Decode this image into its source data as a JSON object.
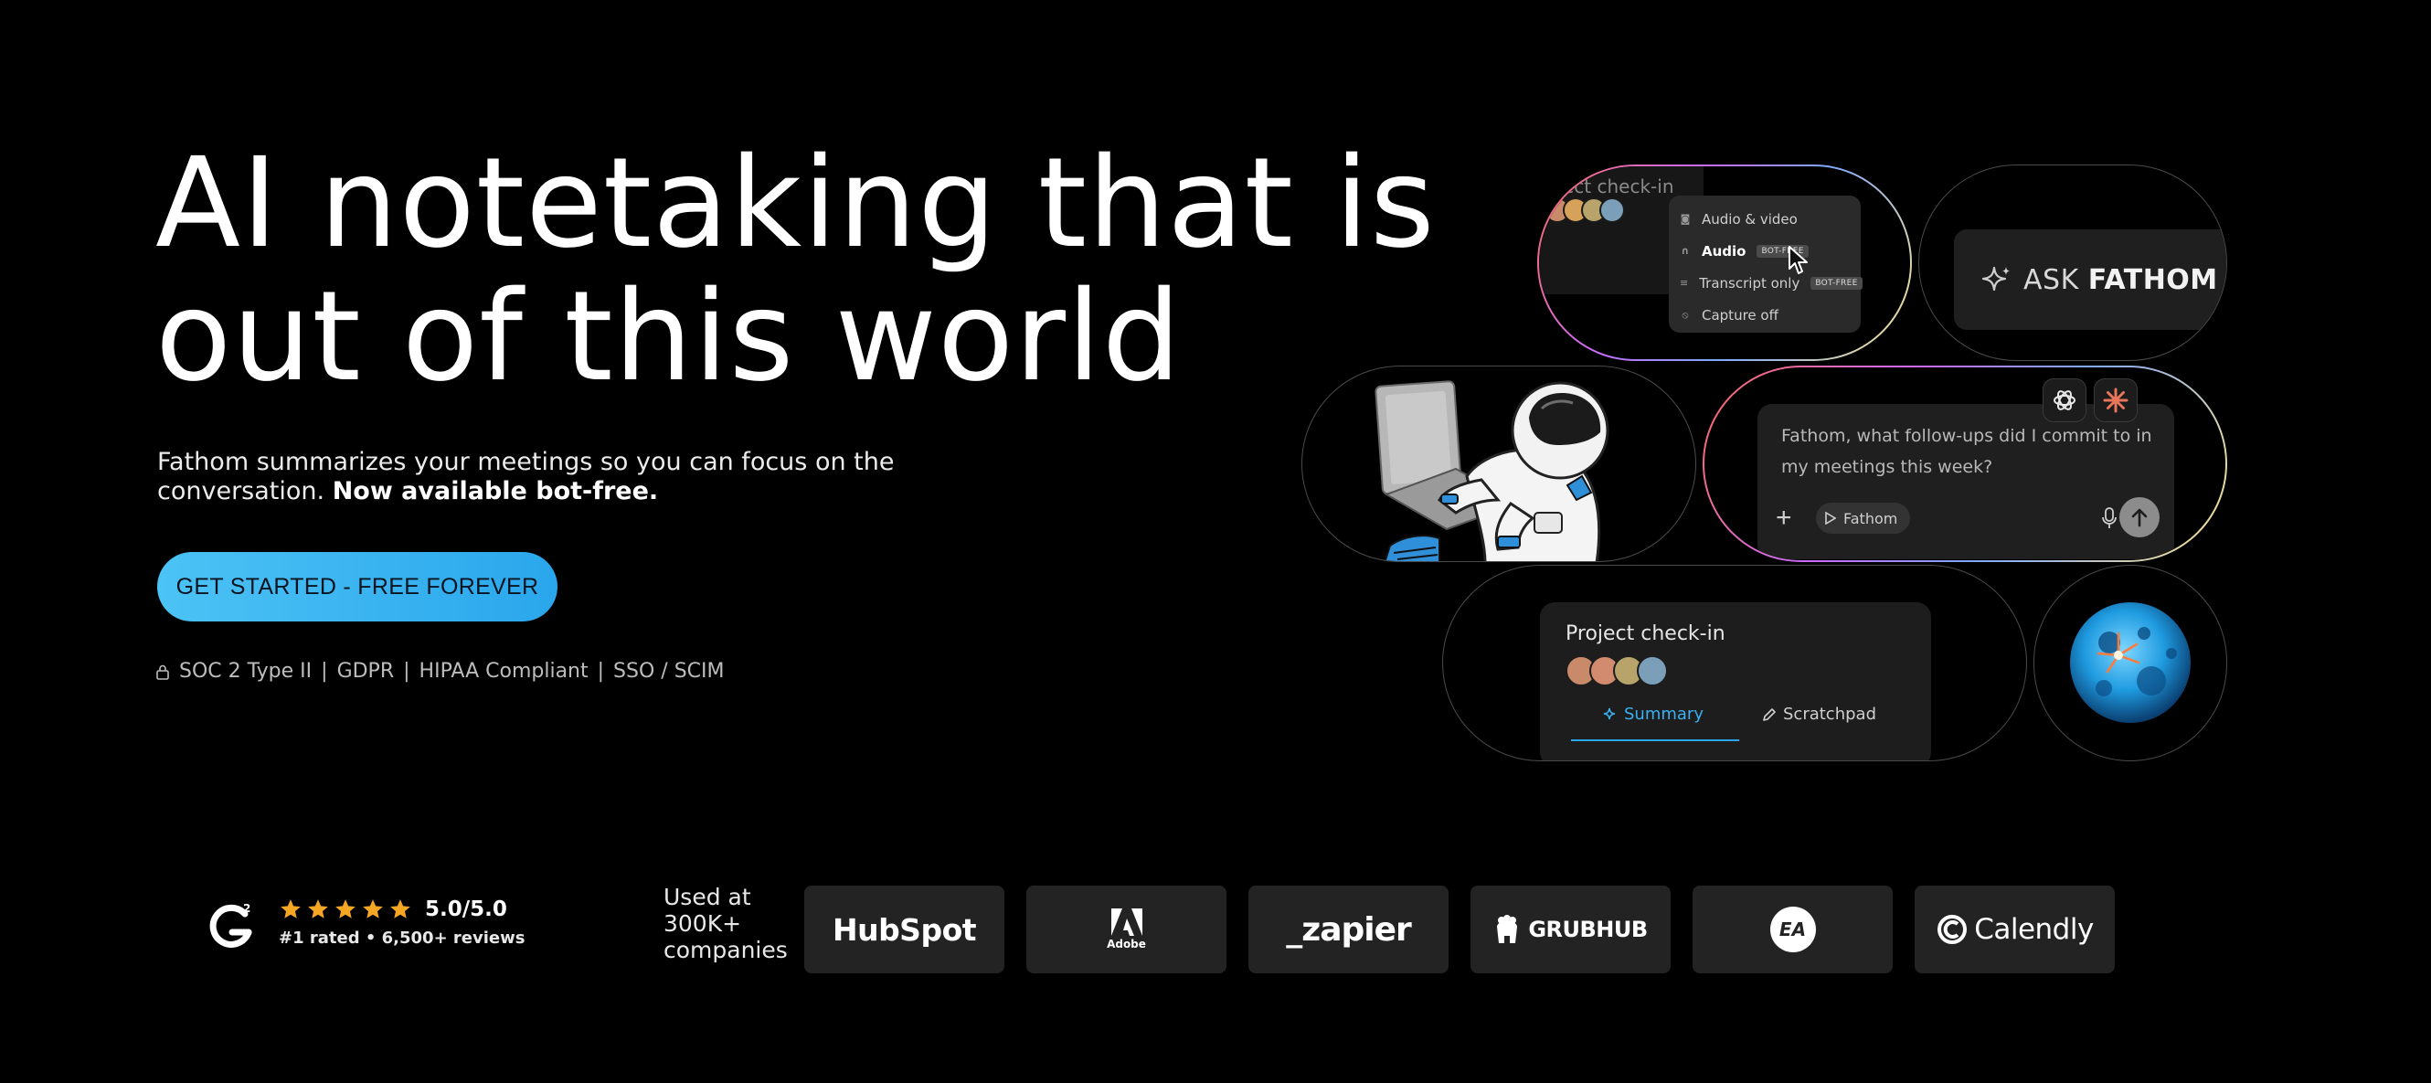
{
  "hero": {
    "headline_line1": "AI notetaking that is",
    "headline_line2": "out of this world",
    "subtitle_regular": "Fathom summarizes your meetings so you can focus on the conversation.",
    "subtitle_bold": "Now available bot-free.",
    "cta_label": "GET STARTED - FREE FOREVER",
    "compliance": [
      "SOC 2 Type II",
      "GDPR",
      "HIPAA Compliant",
      "SSO / SCIM"
    ],
    "separator": "|"
  },
  "recording_menu": {
    "card_title_partial": "ect check-in",
    "items": [
      {
        "label": "Audio & video",
        "tag": ""
      },
      {
        "label": "Audio",
        "tag": "BOT-FREE"
      },
      {
        "label": "Transcript only",
        "tag": "BOT-FREE"
      },
      {
        "label": "Capture off",
        "tag": ""
      }
    ]
  },
  "ask_fathom": {
    "ask": "ASK",
    "brand": "FATHOM"
  },
  "chat": {
    "prompt": "Fathom, what follow-ups did I commit to in my meetings this week?",
    "chip_label": "Fathom"
  },
  "meeting_card": {
    "title": "Project check-in",
    "tab_summary": "Summary",
    "tab_scratchpad": "Scratchpad"
  },
  "social_proof": {
    "score": "5.0/5.0",
    "stars": 5,
    "reviews": "#1 rated • 6,500+ reviews",
    "used_at": "Used at 300K+ companies",
    "companies": [
      "HubSpot",
      "Adobe",
      "_zapier",
      "GRUBHUB",
      "EA",
      "Calendly"
    ]
  },
  "colors": {
    "background": "#000000",
    "cta_gradient_start": "#4cc3f5",
    "cta_gradient_end": "#2aa6ec",
    "star": "#f5a623",
    "accent_blue": "#2aa6ec"
  }
}
